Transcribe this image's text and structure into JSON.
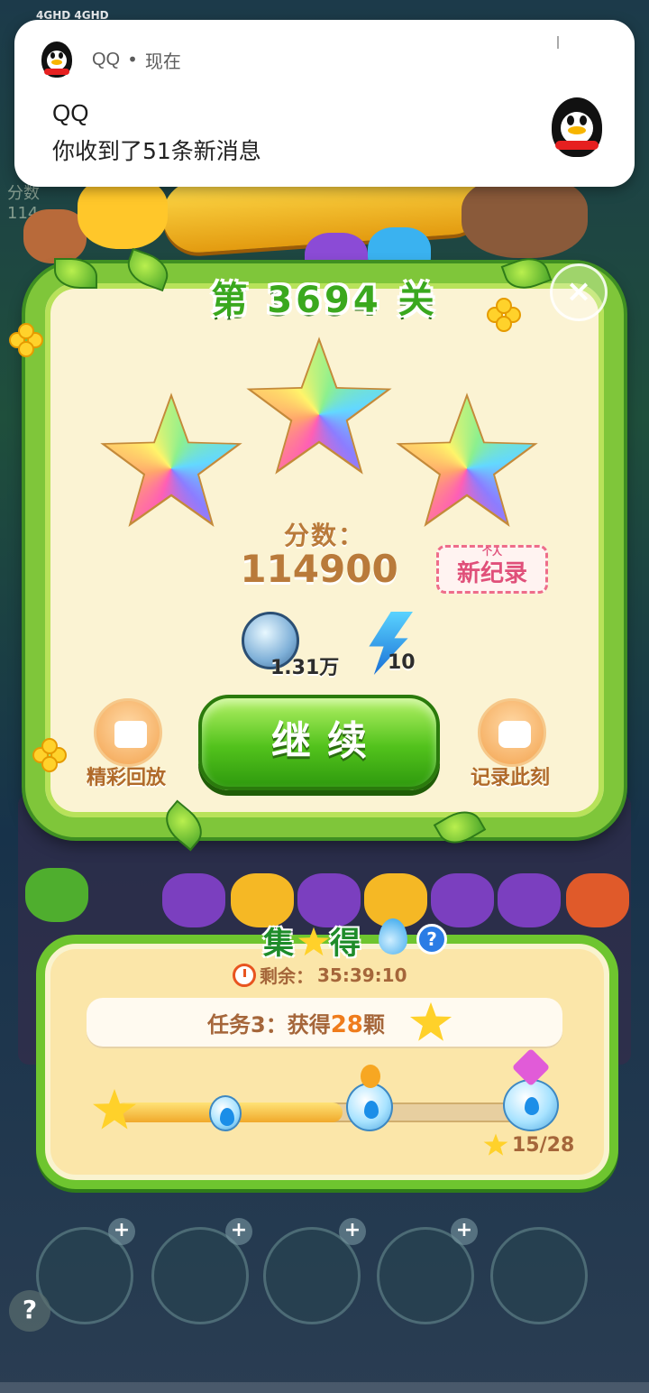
{
  "status_bar": {
    "left": "4GHD 4GHD"
  },
  "notification": {
    "app_name": "QQ",
    "separator": "•",
    "time": "现在",
    "title": "QQ",
    "body": "你收到了51条新消息"
  },
  "background": {
    "score_label": "分数",
    "score_value": "114"
  },
  "result": {
    "level_title": "第 3694 关",
    "close_symbol": "×",
    "stars_earned": 3,
    "score_label": "分数：",
    "score_value": "114900",
    "record_small": "个人",
    "record_label": "新纪录",
    "coin_value": "1.31万",
    "energy_value": "10",
    "replay_label": "精彩回放",
    "continue_label": "继续",
    "capture_label": "记录此刻"
  },
  "quest": {
    "title_left": "集",
    "title_right": "得",
    "help_symbol": "?",
    "timer_label": "剩余：",
    "timer_value": "35:39:10",
    "task_prefix": "任务3：获得",
    "task_count": "28",
    "task_suffix": "颗",
    "progress_current": 15,
    "progress_total": 28,
    "progress_text": "15/28"
  },
  "toolbar": {
    "plus_symbol": "+",
    "help_symbol": "?"
  },
  "colors": {
    "panel_border": "#7fc63a",
    "panel_fill": "#fbf3d3",
    "continue_button": "#52c21c",
    "score_text": "#b97a3a",
    "record_badge": "#e0507a",
    "quest_border": "#6ec52f",
    "progress_fill": "#f0a92b"
  }
}
